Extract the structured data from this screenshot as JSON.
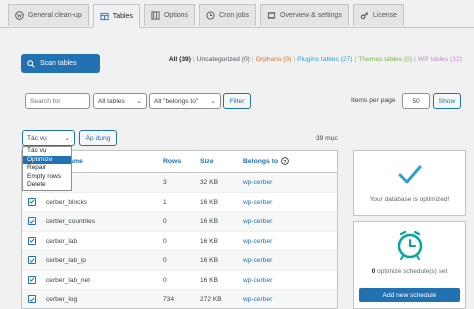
{
  "colors": {
    "accent": "#2271b1",
    "orange": "#d63638",
    "green": "#00a32a"
  },
  "tabs": [
    {
      "label": "General clean-up",
      "icon": "wordpress-icon"
    },
    {
      "label": "Tables",
      "icon": "table-icon",
      "active": true
    },
    {
      "label": "Options",
      "icon": "options-icon"
    },
    {
      "label": "Cron jobs",
      "icon": "clock-icon"
    },
    {
      "label": "Overview & settings",
      "icon": "settings-icon"
    },
    {
      "label": "License",
      "icon": "key-icon"
    }
  ],
  "scan_button": "Scan tables",
  "filters": {
    "all": "All (39)",
    "uncategorized": "Uncategorized (0)",
    "orphans": "Orphans (0)",
    "plugins": "Plugins tables (27)",
    "themes": "Themes tables (0)",
    "wp": "WP tables (12)"
  },
  "search": {
    "placeholder": "Search for"
  },
  "type_select": "All tables",
  "belongs_select": "All \"belongs to\"",
  "filter_button": "Filter",
  "items_per_page": {
    "label": "Items per page",
    "value": "50",
    "button": "Show"
  },
  "bulk": {
    "select_value": "Tác vụ",
    "apply_button": "Áp dụng",
    "count_text": "39 mục",
    "options": [
      "Tác vụ",
      "Optimize",
      "Repair",
      "Empty rows",
      "Delete"
    ],
    "highlighted": 1
  },
  "table": {
    "headers": {
      "name": "Table name",
      "rows": "Rows",
      "size": "Size",
      "belongs": "Belongs to"
    },
    "rows": [
      {
        "name": "",
        "rows": "3",
        "size": "32 KB",
        "belongs": "wp-cerber"
      },
      {
        "name": "cerber_blocks",
        "rows": "1",
        "size": "16 KB",
        "belongs": "wp-cerber"
      },
      {
        "name": "cerber_countries",
        "rows": "0",
        "size": "16 KB",
        "belongs": "wp-cerber"
      },
      {
        "name": "cerber_lab",
        "rows": "0",
        "size": "16 KB",
        "belongs": "wp-cerber"
      },
      {
        "name": "cerber_lab_ip",
        "rows": "0",
        "size": "16 KB",
        "belongs": "wp-cerber"
      },
      {
        "name": "cerber_lab_net",
        "rows": "0",
        "size": "16 KB",
        "belongs": "wp-cerber"
      },
      {
        "name": "cerber_log",
        "rows": "734",
        "size": "272 KB",
        "belongs": "wp-cerber"
      }
    ]
  },
  "cards": {
    "optimized": "Your database is optimized!",
    "schedules_count": "0",
    "schedules_text": "optimize schedule(s) set",
    "add_button": "Add new schedule"
  }
}
